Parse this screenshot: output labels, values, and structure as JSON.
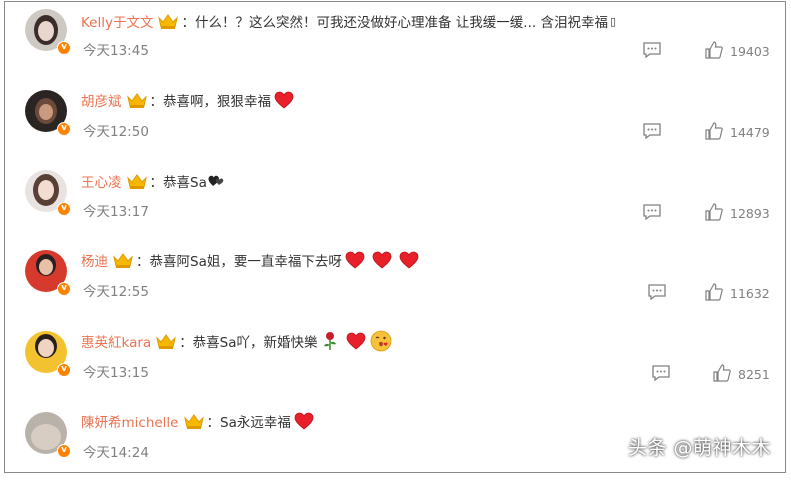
{
  "comments": [
    {
      "user": "Kelly于文文",
      "text": "：什么！？这么突然！可我还没做好心理准备 让我缓一缓... 含泪祝幸福",
      "time": "今天13:45",
      "likes": "19403",
      "emojis": [],
      "text_suffix": "▯"
    },
    {
      "user": "胡彦斌",
      "text": "：恭喜啊，狠狠幸福",
      "time": "今天12:50",
      "likes": "14479",
      "emojis": [
        "heart"
      ]
    },
    {
      "user": "王心凌",
      "text": "：恭喜Sa",
      "time": "今天13:17",
      "likes": "12893",
      "emojis": [
        "black-heart"
      ]
    },
    {
      "user": "杨迪",
      "text": "：恭喜阿Sa姐，要一直幸福下去呀",
      "time": "今天12:55",
      "likes": "11632",
      "emojis": [
        "heart",
        "heart",
        "heart"
      ]
    },
    {
      "user": "惠英紅kara",
      "text": "：恭喜Sa吖，新婚快樂",
      "time": "今天13:15",
      "likes": "8251",
      "emojis": [
        "rose",
        "heart",
        "kiss"
      ]
    },
    {
      "user": "陳妍希michelle",
      "text": "：Sa永远幸福",
      "time": "今天14:24",
      "likes": "",
      "emojis": [
        "heart"
      ]
    }
  ],
  "watermark": "头条 @萌神木木",
  "colors": {
    "username": "#eb7350",
    "badge": "#ff8200",
    "heart": "#e8202a",
    "meta": "#808080"
  }
}
